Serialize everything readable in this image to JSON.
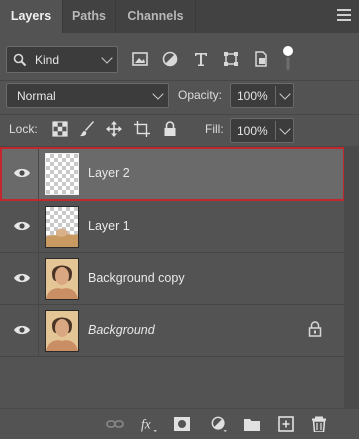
{
  "tabs": [
    {
      "label": "Layers",
      "active": true
    },
    {
      "label": "Paths",
      "active": false
    },
    {
      "label": "Channels",
      "active": false
    }
  ],
  "filter": {
    "kind_label": "Kind",
    "icons": [
      "image-filter-icon",
      "adjustment-filter-icon",
      "type-filter-icon",
      "shape-filter-icon",
      "smart-object-filter-icon",
      "filter-toggle-icon"
    ]
  },
  "blend": {
    "mode": "Normal"
  },
  "opacity": {
    "label": "Opacity:",
    "value": "100%"
  },
  "lock": {
    "label": "Lock:",
    "icons": [
      "lock-transparent-pixels-icon",
      "lock-image-pixels-icon",
      "lock-position-icon",
      "lock-artboard-icon",
      "lock-all-icon"
    ]
  },
  "fill": {
    "label": "Fill:",
    "value": "100%"
  },
  "layers": [
    {
      "name": "Layer 2",
      "selected": true,
      "thumb": "transparent",
      "italic": false,
      "locked": false
    },
    {
      "name": "Layer 1",
      "selected": false,
      "thumb": "partial-photo",
      "italic": false,
      "locked": false
    },
    {
      "name": "Background copy",
      "selected": false,
      "thumb": "photo",
      "italic": false,
      "locked": false
    },
    {
      "name": "Background",
      "selected": false,
      "thumb": "photo",
      "italic": true,
      "locked": true
    }
  ],
  "bottom_icons": [
    "link-layers-icon",
    "fx-icon",
    "add-mask-icon",
    "new-adjustment-layer-icon",
    "new-group-icon",
    "new-layer-icon",
    "delete-layer-icon"
  ],
  "colors": {
    "selection_outline": "#c1272d",
    "panel_bg": "#535353",
    "selected_row": "#6a6a6a"
  }
}
